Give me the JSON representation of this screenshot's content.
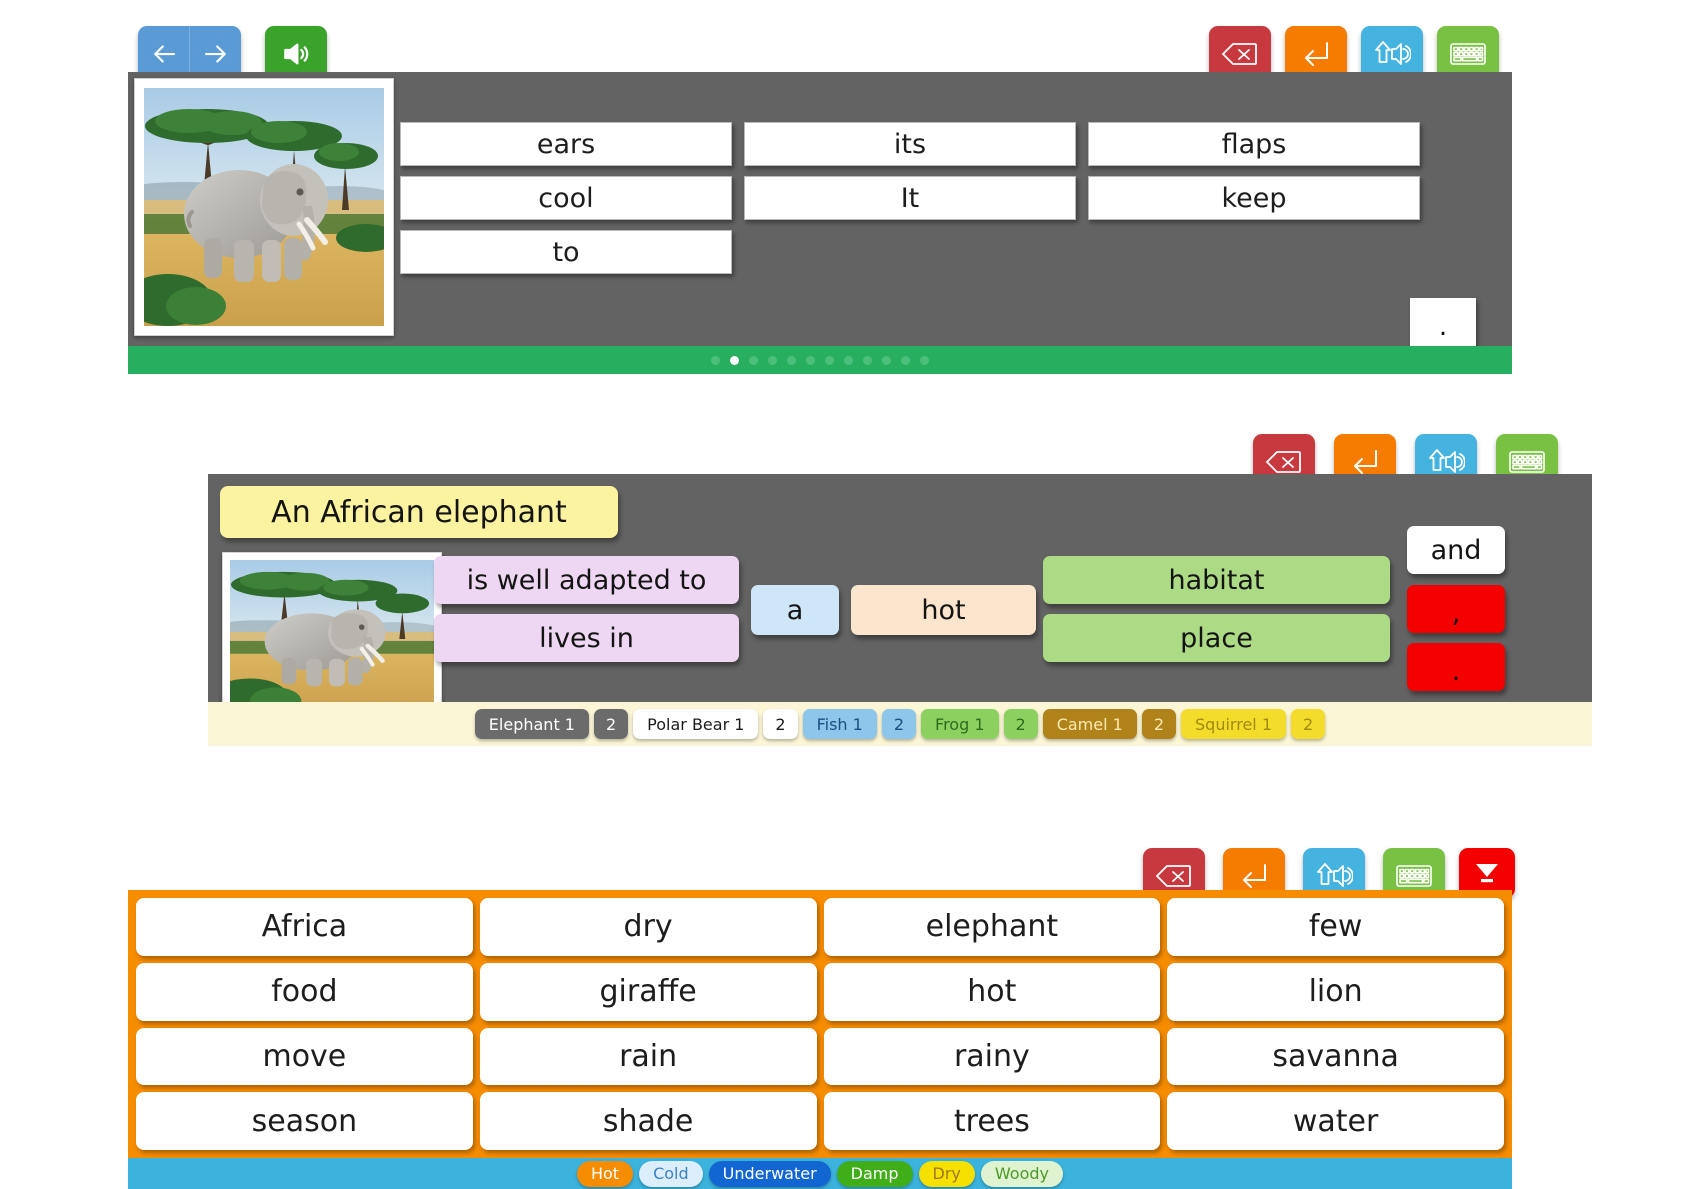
{
  "panel1": {
    "nav": {
      "back_label": "back-arrow",
      "forward_label": "forward-arrow"
    },
    "speaker_label": "speaker",
    "toolbar": [
      {
        "name": "backspace",
        "icon": "backspace-icon"
      },
      {
        "name": "enter",
        "icon": "enter-icon"
      },
      {
        "name": "read-aloud",
        "icon": "read-aloud-icon"
      },
      {
        "name": "keyboard",
        "icon": "keyboard-icon"
      }
    ],
    "image_alt": "African elephant in savanna",
    "words": [
      "ears",
      "its",
      "flaps",
      "cool",
      "It",
      "keep",
      "to"
    ],
    "period_tile": ".",
    "dots_total": 12,
    "dots_active_index": 1
  },
  "panel2": {
    "toolbar": [
      {
        "name": "backspace",
        "icon": "backspace-icon"
      },
      {
        "name": "enter",
        "icon": "enter-icon"
      },
      {
        "name": "read-aloud",
        "icon": "read-aloud-icon"
      },
      {
        "name": "keyboard",
        "icon": "keyboard-icon"
      }
    ],
    "title": "An African elephant",
    "image_alt": "African elephant in savanna",
    "tiles": {
      "phrase_1": "is well adapted to",
      "phrase_2": "lives in",
      "article": "a",
      "adjective": "hot",
      "noun_1": "habitat",
      "noun_2": "place",
      "conjunction": "and",
      "comma": ",",
      "period": "."
    },
    "tabs": [
      {
        "label": "Elephant 1",
        "bg": "#6b6b6b",
        "fg": "#ffffff"
      },
      {
        "label": "2",
        "bg": "#6b6b6b",
        "fg": "#ffffff"
      },
      {
        "label": "Polar Bear 1",
        "bg": "#ffffff",
        "fg": "#1b1b1b"
      },
      {
        "label": "2",
        "bg": "#ffffff",
        "fg": "#1b1b1b"
      },
      {
        "label": "Fish 1",
        "bg": "#8cc6ea",
        "fg": "#1b4e82"
      },
      {
        "label": "2",
        "bg": "#8cc6ea",
        "fg": "#1b4e82"
      },
      {
        "label": "Frog 1",
        "bg": "#8cd15f",
        "fg": "#2f6b1f"
      },
      {
        "label": "2",
        "bg": "#8cd15f",
        "fg": "#2f6b1f"
      },
      {
        "label": "Camel 1",
        "bg": "#b0821a",
        "fg": "#ffe9b0"
      },
      {
        "label": "2",
        "bg": "#b0821a",
        "fg": "#ffe9b0"
      },
      {
        "label": "Squirrel 1",
        "bg": "#f3dd2a",
        "fg": "#a08a10"
      },
      {
        "label": "2",
        "bg": "#f3dd2a",
        "fg": "#a08a10"
      }
    ]
  },
  "panel3": {
    "toolbar": [
      {
        "name": "backspace",
        "icon": "backspace-icon"
      },
      {
        "name": "enter",
        "icon": "enter-icon"
      },
      {
        "name": "read-aloud",
        "icon": "read-aloud-icon"
      },
      {
        "name": "keyboard",
        "icon": "keyboard-icon"
      },
      {
        "name": "collapse",
        "icon": "collapse-icon"
      }
    ],
    "words": [
      "Africa",
      "dry",
      "elephant",
      "few",
      "food",
      "giraffe",
      "hot",
      "lion",
      "move",
      "rain",
      "rainy",
      "savanna",
      "season",
      "shade",
      "trees",
      "water"
    ],
    "habitats": [
      {
        "label": "Hot",
        "bg": "#f68c00",
        "fg": "#ffffff"
      },
      {
        "label": "Cold",
        "bg": "#dceefb",
        "fg": "#3b82c4"
      },
      {
        "label": "Underwater",
        "bg": "#1266d1",
        "fg": "#ffffff"
      },
      {
        "label": "Damp",
        "bg": "#3fae18",
        "fg": "#ffffff"
      },
      {
        "label": "Dry",
        "bg": "#f5e000",
        "fg": "#a07a10"
      },
      {
        "label": "Woody",
        "bg": "#dff3d0",
        "fg": "#4c9a2a"
      }
    ]
  },
  "colors": {
    "panel_bg": "#636363",
    "green_bar": "#27ae5f",
    "orange_frame": "#f68c00",
    "blue_bar": "#3bb3dd"
  }
}
